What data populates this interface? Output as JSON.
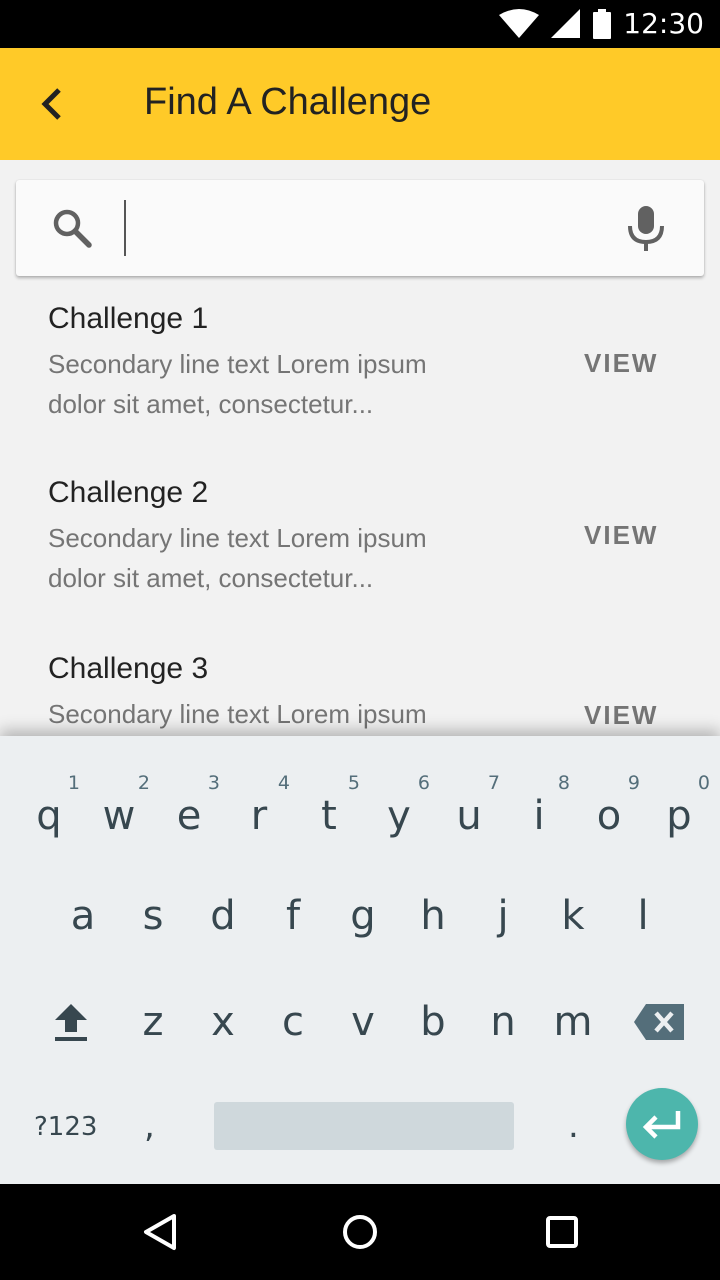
{
  "status_bar": {
    "time": "12:30",
    "icons": [
      "wifi-icon",
      "signal-icon",
      "battery-icon"
    ]
  },
  "app_bar": {
    "title": "Find A Challenge",
    "back_icon": "chevron-left-icon",
    "color": "#ffca28"
  },
  "search": {
    "value": "",
    "placeholder": "",
    "search_icon": "search-icon",
    "mic_icon": "mic-icon"
  },
  "challenges": [
    {
      "title": "Challenge 1",
      "desc_line1": "Secondary line text Lorem ipsum",
      "desc_line2": "dolor sit amet, consectetur...",
      "action": "VIEW"
    },
    {
      "title": "Challenge 2",
      "desc_line1": "Secondary line text Lorem ipsum",
      "desc_line2": "dolor sit amet, consectetur...",
      "action": "VIEW"
    },
    {
      "title": "Challenge 3",
      "desc_line1": "Secondary line text Lorem ipsum",
      "desc_line2": "",
      "action": "VIEW"
    }
  ],
  "keyboard": {
    "row1": [
      {
        "key": "q",
        "hint": "1"
      },
      {
        "key": "w",
        "hint": "2"
      },
      {
        "key": "e",
        "hint": "3"
      },
      {
        "key": "r",
        "hint": "4"
      },
      {
        "key": "t",
        "hint": "5"
      },
      {
        "key": "y",
        "hint": "6"
      },
      {
        "key": "u",
        "hint": "7"
      },
      {
        "key": "i",
        "hint": "8"
      },
      {
        "key": "o",
        "hint": "9"
      },
      {
        "key": "p",
        "hint": "0"
      }
    ],
    "row2": [
      "a",
      "s",
      "d",
      "f",
      "g",
      "h",
      "j",
      "k",
      "l"
    ],
    "row3": [
      "z",
      "x",
      "c",
      "v",
      "b",
      "n",
      "m"
    ],
    "symbols_label": "?123",
    "comma": ",",
    "period": ".",
    "accent_color": "#4db6ac"
  },
  "nav_bar": {
    "icons": [
      "back-triangle-icon",
      "home-circle-icon",
      "recents-square-icon"
    ]
  }
}
